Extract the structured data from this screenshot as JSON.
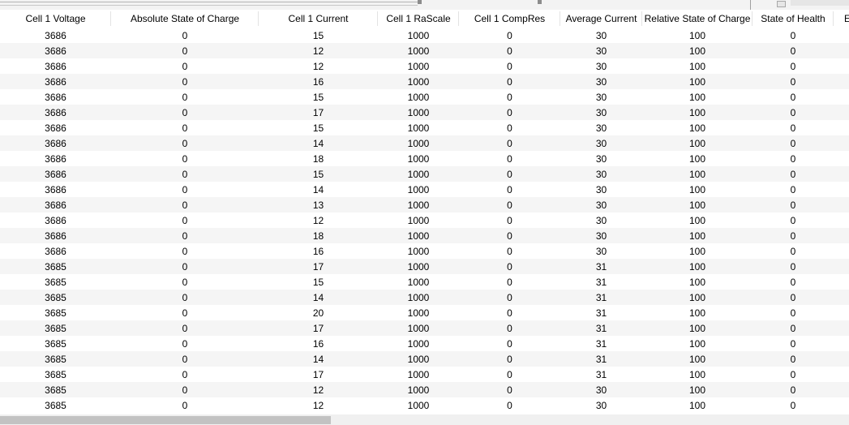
{
  "columns": [
    "Cell 1 Voltage",
    "Absolute State of Charge",
    "Cell 1 Current",
    "Cell 1 RaScale",
    "Cell 1 CompRes",
    "Average Current",
    "Relative State of Charge",
    "State of Health",
    "E"
  ],
  "rows": [
    [
      "3686",
      "0",
      "15",
      "1000",
      "0",
      "30",
      "100",
      "0"
    ],
    [
      "3686",
      "0",
      "12",
      "1000",
      "0",
      "30",
      "100",
      "0"
    ],
    [
      "3686",
      "0",
      "12",
      "1000",
      "0",
      "30",
      "100",
      "0"
    ],
    [
      "3686",
      "0",
      "16",
      "1000",
      "0",
      "30",
      "100",
      "0"
    ],
    [
      "3686",
      "0",
      "15",
      "1000",
      "0",
      "30",
      "100",
      "0"
    ],
    [
      "3686",
      "0",
      "17",
      "1000",
      "0",
      "30",
      "100",
      "0"
    ],
    [
      "3686",
      "0",
      "15",
      "1000",
      "0",
      "30",
      "100",
      "0"
    ],
    [
      "3686",
      "0",
      "14",
      "1000",
      "0",
      "30",
      "100",
      "0"
    ],
    [
      "3686",
      "0",
      "18",
      "1000",
      "0",
      "30",
      "100",
      "0"
    ],
    [
      "3686",
      "0",
      "15",
      "1000",
      "0",
      "30",
      "100",
      "0"
    ],
    [
      "3686",
      "0",
      "14",
      "1000",
      "0",
      "30",
      "100",
      "0"
    ],
    [
      "3686",
      "0",
      "13",
      "1000",
      "0",
      "30",
      "100",
      "0"
    ],
    [
      "3686",
      "0",
      "12",
      "1000",
      "0",
      "30",
      "100",
      "0"
    ],
    [
      "3686",
      "0",
      "18",
      "1000",
      "0",
      "30",
      "100",
      "0"
    ],
    [
      "3686",
      "0",
      "16",
      "1000",
      "0",
      "30",
      "100",
      "0"
    ],
    [
      "3685",
      "0",
      "17",
      "1000",
      "0",
      "31",
      "100",
      "0"
    ],
    [
      "3685",
      "0",
      "15",
      "1000",
      "0",
      "31",
      "100",
      "0"
    ],
    [
      "3685",
      "0",
      "14",
      "1000",
      "0",
      "31",
      "100",
      "0"
    ],
    [
      "3685",
      "0",
      "20",
      "1000",
      "0",
      "31",
      "100",
      "0"
    ],
    [
      "3685",
      "0",
      "17",
      "1000",
      "0",
      "31",
      "100",
      "0"
    ],
    [
      "3685",
      "0",
      "16",
      "1000",
      "0",
      "31",
      "100",
      "0"
    ],
    [
      "3685",
      "0",
      "14",
      "1000",
      "0",
      "31",
      "100",
      "0"
    ],
    [
      "3685",
      "0",
      "17",
      "1000",
      "0",
      "31",
      "100",
      "0"
    ],
    [
      "3685",
      "0",
      "12",
      "1000",
      "0",
      "30",
      "100",
      "0"
    ],
    [
      "3685",
      "0",
      "12",
      "1000",
      "0",
      "30",
      "100",
      "0"
    ]
  ],
  "scrollbar": {
    "horizontal_thumb_fraction": 0.39
  }
}
